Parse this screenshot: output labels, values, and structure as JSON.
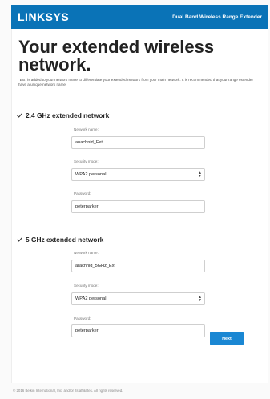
{
  "header": {
    "logo_text": "LINKSYS",
    "product_name": "Dual Band Wireless Range Extender",
    "brand_color": "#0a73b7"
  },
  "page": {
    "title": "Your extended wireless network.",
    "intro": "\"Ext\" is added to your network name to differentiate your extended network from your main network. It is recommended that your range extender have a unique network name."
  },
  "band_24": {
    "heading": "2.4 GHz extended network",
    "network_name_label": "Network name:",
    "network_name_value": "anachnid_Ext",
    "security_mode_label": "Security mode:",
    "security_mode_value": "WPA2 personal",
    "password_label": "Password:",
    "password_value": "peterparker"
  },
  "band_5": {
    "heading": "5 GHz extended network",
    "network_name_label": "Network name:",
    "network_name_value": "arachnid_5GHz_Ext",
    "security_mode_label": "Security mode:",
    "security_mode_value": "WPA2 personal",
    "password_label": "Password:",
    "password_value": "peterparker"
  },
  "actions": {
    "next_label": "Next",
    "button_color": "#1a87d3"
  },
  "footer": {
    "copyright": "© 2016 Belkin International, Inc. and/or its affiliates. All rights reserved."
  }
}
